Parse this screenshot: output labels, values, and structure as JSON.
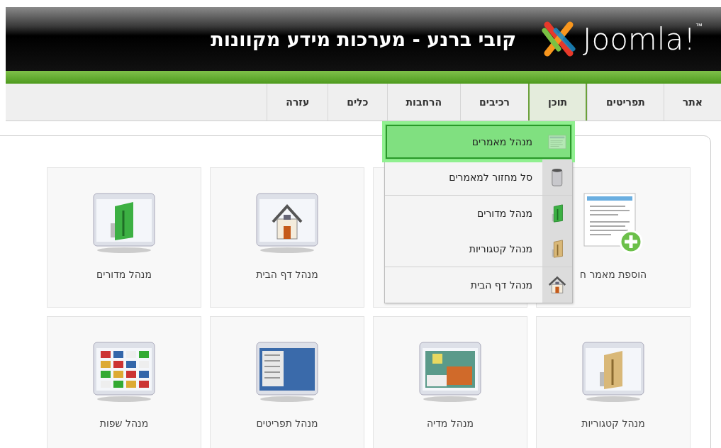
{
  "header": {
    "logo_text": "Joomla!",
    "logo_mark": "™",
    "title": "קובי ברנע - מערכות מידע מקוונות"
  },
  "tabs": [
    {
      "label": "אתר",
      "selected": false
    },
    {
      "label": "תפריטים",
      "selected": false
    },
    {
      "label": "תוכן",
      "selected": true
    },
    {
      "label": "רכיבים",
      "selected": false
    },
    {
      "label": "הרחבות",
      "selected": false
    },
    {
      "label": "כלים",
      "selected": false
    },
    {
      "label": "עזרה",
      "selected": false
    }
  ],
  "dropdown": {
    "groups": [
      [
        {
          "label": "מנהל מאמרים",
          "kind": "articles",
          "highlighted": true
        },
        {
          "label": "סל מחזור למאמרים",
          "kind": "trash",
          "highlighted": false
        }
      ],
      [
        {
          "label": "מנהל מדורים",
          "kind": "sections",
          "highlighted": false
        },
        {
          "label": "מנהל קטגוריות",
          "kind": "categories",
          "highlighted": false
        }
      ],
      [
        {
          "label": "מנהל דף הבית",
          "kind": "home",
          "highlighted": false
        }
      ]
    ]
  },
  "cards": [
    {
      "label": "הוספת מאמר ח",
      "kind": "add-article"
    },
    {
      "kind": "hidden"
    },
    {
      "label": "מנהל דף הבית",
      "kind": "home"
    },
    {
      "label": "מנהל מדורים",
      "kind": "sections"
    },
    {
      "label": "מנהל קטגוריות",
      "kind": "categories"
    },
    {
      "label": "מנהל מדיה",
      "kind": "media"
    },
    {
      "label": "מנהל תפריטים",
      "kind": "menus"
    },
    {
      "label": "מנהל שפות",
      "kind": "languages"
    }
  ]
}
